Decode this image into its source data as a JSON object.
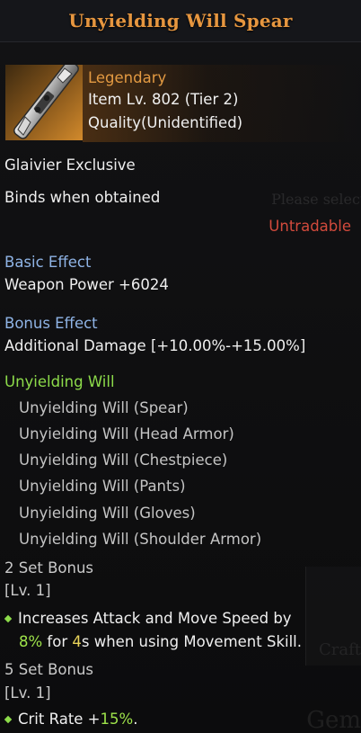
{
  "tooltip": {
    "title": "Unyielding Will Spear",
    "item": {
      "icon": "spear-item-icon",
      "grade": "Legendary",
      "item_level": "Item Lv. 802 (Tier 2)",
      "quality": "Quality(Unidentified)"
    },
    "exclusive": "Glaivier Exclusive",
    "binding": "Binds when obtained",
    "tradable": "Untradable",
    "basic_effect": {
      "label": "Basic Effect",
      "value": "Weapon Power +6024"
    },
    "bonus_effect": {
      "label": "Bonus Effect",
      "value": "Additional Damage [+10.00%-+15.00%]"
    },
    "set": {
      "name": "Unyielding Will",
      "pieces": [
        "Unyielding Will (Spear)",
        "Unyielding Will (Head Armor)",
        "Unyielding Will (Chestpiece)",
        "Unyielding Will (Pants)",
        "Unyielding Will (Gloves)",
        "Unyielding Will (Shoulder Armor)"
      ],
      "bonus2": {
        "label": "2 Set Bonus",
        "level": "[Lv. 1]",
        "line1": "Increases Attack and Move Speed by",
        "pct": "8%",
        "for": " for ",
        "secs": "4",
        "rest": "s when using Movement Skill."
      },
      "bonus5": {
        "label": "5 Set Bonus",
        "level": "[Lv. 1]",
        "prefix": "Crit Rate +",
        "pct": "15%",
        "suffix": "."
      }
    }
  },
  "background": {
    "hint": "Please select a",
    "craft": "Craft",
    "gem": "Gem"
  },
  "colors": {
    "title": "#e6963f",
    "grade_legendary": "#e39a42",
    "section_label": "#8fb4e6",
    "set_name": "#8ddc4a",
    "untradable": "#d24a3c",
    "highlight_value": "#9ee34a",
    "highlight_seconds": "#e8d35a"
  }
}
